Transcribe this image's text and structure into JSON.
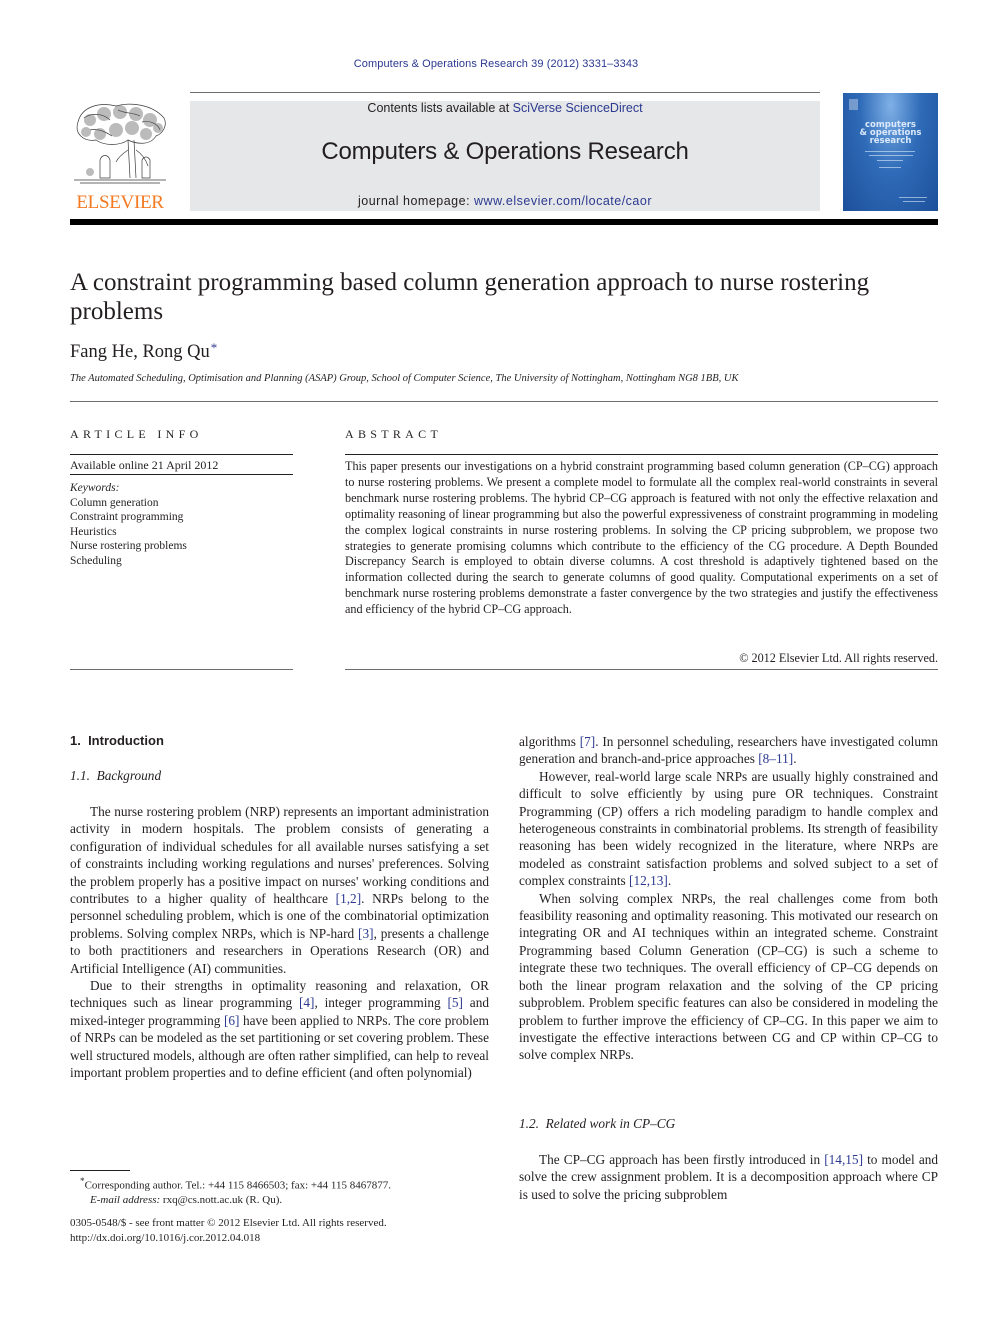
{
  "running_header": "Computers & Operations Research 39 (2012) 3331–3343",
  "masthead": {
    "publisher_name": "ELSEVIER",
    "contents_prefix": "Contents lists available at ",
    "contents_link": "SciVerse ScienceDirect",
    "journal_title": "Computers & Operations Research",
    "homepage_prefix": "journal homepage: ",
    "homepage_link": "www.elsevier.com/locate/caor",
    "cover_title_lines": [
      "computers",
      "& operations",
      "research"
    ],
    "colors": {
      "publisher_orange": "#f47920",
      "link_blue": "#2b3990",
      "masthead_gray": "#e6e7e8",
      "cover_blue": "#2f6bb8"
    }
  },
  "article": {
    "title": "A constraint programming based column generation approach to nurse rostering problems",
    "authors": "Fang He, Rong Qu",
    "author_marker": "*",
    "affiliation": "The Automated Scheduling, Optimisation and Planning (ASAP) Group, School of Computer Science, The University of Nottingham, Nottingham NG8 1BB, UK"
  },
  "article_info": {
    "heading": "ARTICLE INFO",
    "available_online": "Available online 21 April 2012",
    "keywords_label": "Keywords:",
    "keywords": [
      "Column generation",
      "Constraint programming",
      "Heuristics",
      "Nurse rostering problems",
      "Scheduling"
    ]
  },
  "abstract": {
    "heading": "ABSTRACT",
    "text": "This paper presents our investigations on a hybrid constraint programming based column generation (CP–CG) approach to nurse rostering problems. We present a complete model to formulate all the complex real-world constraints in several benchmark nurse rostering problems. The hybrid CP–CG approach is featured with not only the effective relaxation and optimality reasoning of linear programming but also the powerful expressiveness of constraint programming in modeling the complex logical constraints in nurse rostering problems. In solving the CP pricing subproblem, we propose two strategies to generate promising columns which contribute to the efficiency of the CG procedure. A Depth Bounded Discrepancy Search is employed to obtain diverse columns. A cost threshold is adaptively tightened based on the information collected during the search to generate columns of good quality. Computational experiments on a set of benchmark nurse rostering problems demonstrate a faster convergence by the two strategies and justify the effectiveness and efficiency of the hybrid CP–CG approach.",
    "copyright": "© 2012 Elsevier Ltd. All rights reserved."
  },
  "body": {
    "section1_heading": "1.  Introduction",
    "section11_heading": "1.1.  Background",
    "section12_heading": "1.2.  Related work in CP–CG",
    "left_paragraphs": [
      {
        "segments": [
          {
            "t": "The nurse rostering problem (NRP) represents an important administration activity in modern hospitals. The problem consists of generating a configuration of individual schedules for all available nurses satisfying a set of constraints including working regulations and nurses' preferences. Solving the problem properly has a positive impact on nurses' working conditions and contributes to a higher quality of healthcare "
          },
          {
            "ref": "[1,2]"
          },
          {
            "t": ". NRPs belong to the personnel scheduling problem, which is one of the combinatorial optimization problems. Solving complex NRPs, which is NP-hard "
          },
          {
            "ref": "[3]"
          },
          {
            "t": ", presents a challenge to both practitioners and researchers in Operations Research (OR) and Artificial Intelligence (AI) communities."
          }
        ]
      },
      {
        "segments": [
          {
            "t": "Due to their strengths in optimality reasoning and relaxation, OR techniques such as linear programming "
          },
          {
            "ref": "[4]"
          },
          {
            "t": ", integer programming "
          },
          {
            "ref": "[5]"
          },
          {
            "t": " and mixed-integer programming "
          },
          {
            "ref": "[6]"
          },
          {
            "t": " have been applied to NRPs. The core problem of NRPs can be modeled as the set partitioning or set covering problem. These well structured models, although are often rather simplified, can help to reveal important problem properties and to define efficient (and often polynomial)"
          }
        ]
      }
    ],
    "right_paragraphs": [
      {
        "noindent": true,
        "segments": [
          {
            "t": "algorithms "
          },
          {
            "ref": "[7]"
          },
          {
            "t": ". In personnel scheduling, researchers have investigated column generation and branch-and-price approaches "
          },
          {
            "ref": "[8–11]"
          },
          {
            "t": "."
          }
        ]
      },
      {
        "segments": [
          {
            "t": "However, real-world large scale NRPs are usually highly constrained and difficult to solve efficiently by using pure OR techniques. Constraint Programming (CP) offers a rich modeling paradigm to handle complex and heterogeneous constraints in combinatorial problems. Its strength of feasibility reasoning has been widely recognized in the literature, where NRPs are modeled as constraint satisfaction problems and solved subject to a set of complex constraints "
          },
          {
            "ref": "[12,13]"
          },
          {
            "t": "."
          }
        ]
      },
      {
        "segments": [
          {
            "t": "When solving complex NRPs, the real challenges come from both feasibility reasoning and optimality reasoning. This motivated our research on integrating OR and AI techniques within an integrated scheme. Constraint Programming based Column Generation (CP–CG) is such a scheme to integrate these two techniques. The overall efficiency of CP–CG depends on both the linear program relaxation and the solving of the CP pricing subproblem. Problem specific features can also be considered in modeling the problem to further improve the efficiency of CP–CG. In this paper we aim to investigate the effective interactions between CG and CP within CP–CG to solve complex NRPs."
          }
        ]
      }
    ],
    "right_paragraphs_2": [
      {
        "segments": [
          {
            "t": "The CP–CG approach has been firstly introduced in "
          },
          {
            "ref": "[14,15]"
          },
          {
            "t": " to model and solve the crew assignment problem. It is a decomposition approach where CP is used to solve the pricing subproblem"
          }
        ]
      }
    ]
  },
  "footnote": {
    "marker": "*",
    "corresponding": "Corresponding author. Tel.: +44 115 8466503; fax: +44 115 8467877.",
    "email_label": "E-mail address:",
    "email": "rxq@cs.nott.ac.uk (R. Qu)."
  },
  "front_matter": {
    "issn_line": "0305-0548/$ - see front matter © 2012 Elsevier Ltd. All rights reserved.",
    "doi_line": "http://dx.doi.org/10.1016/j.cor.2012.04.018"
  }
}
